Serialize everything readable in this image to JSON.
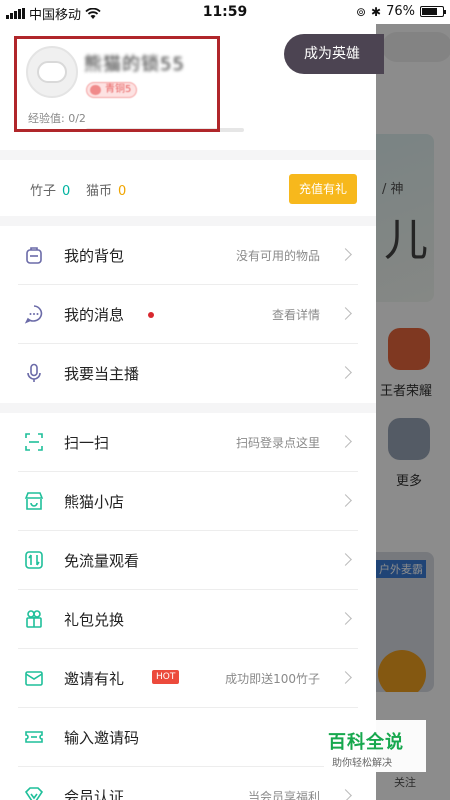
{
  "status_bar": {
    "carrier": "中国移动",
    "time": "11:59",
    "battery": "76%",
    "battery_level": 0.76
  },
  "profile": {
    "username": "熊猫的锁55",
    "level_badge": "青铜5",
    "exp_label": "经验值: 0/2",
    "exp_progress": 0.0,
    "hero_button": "成为英雄"
  },
  "wallet": {
    "bamboo_label": "竹子",
    "bamboo_value": "0",
    "bamboo_color": "#00b3a0",
    "catcoin_label": "猫币",
    "catcoin_value": "0",
    "catcoin_color": "#f0a500",
    "recharge_button": "充值有礼",
    "recharge_color": "#f7b81c"
  },
  "menu_group_1": [
    {
      "label": "我的背包",
      "hint": "没有可用的物品",
      "icon": "backpack-icon"
    },
    {
      "label": "我的消息",
      "hint": "查看详情",
      "icon": "message-icon",
      "dot": true
    },
    {
      "label": "我要当主播",
      "hint": "",
      "icon": "microphone-icon"
    }
  ],
  "menu_group_2": [
    {
      "label": "扫一扫",
      "hint": "扫码登录点这里",
      "icon": "scan-icon"
    },
    {
      "label": "熊猫小店",
      "hint": "",
      "icon": "shop-icon"
    },
    {
      "label": "免流量观看",
      "hint": "",
      "icon": "data-free-icon"
    },
    {
      "label": "礼包兑换",
      "hint": "",
      "icon": "gift-icon"
    },
    {
      "label": "邀请有礼",
      "hint": "成功即送100竹子",
      "icon": "invite-icon",
      "badge": "HOT"
    },
    {
      "label": "输入邀请码",
      "hint": "",
      "icon": "ticket-icon"
    },
    {
      "label": "会员认证",
      "hint": "当会员享福利",
      "icon": "vip-icon"
    }
  ],
  "background_app": {
    "banner_text_1": "/ 神",
    "banner_text_2": "儿",
    "tile_1_label": "王者荣耀",
    "tile_2_label": "更多",
    "live_tag": "户外麦霸",
    "follow_label": "关注"
  },
  "watermark": {
    "title": "百科全说",
    "subtitle": "助你轻松解决"
  }
}
